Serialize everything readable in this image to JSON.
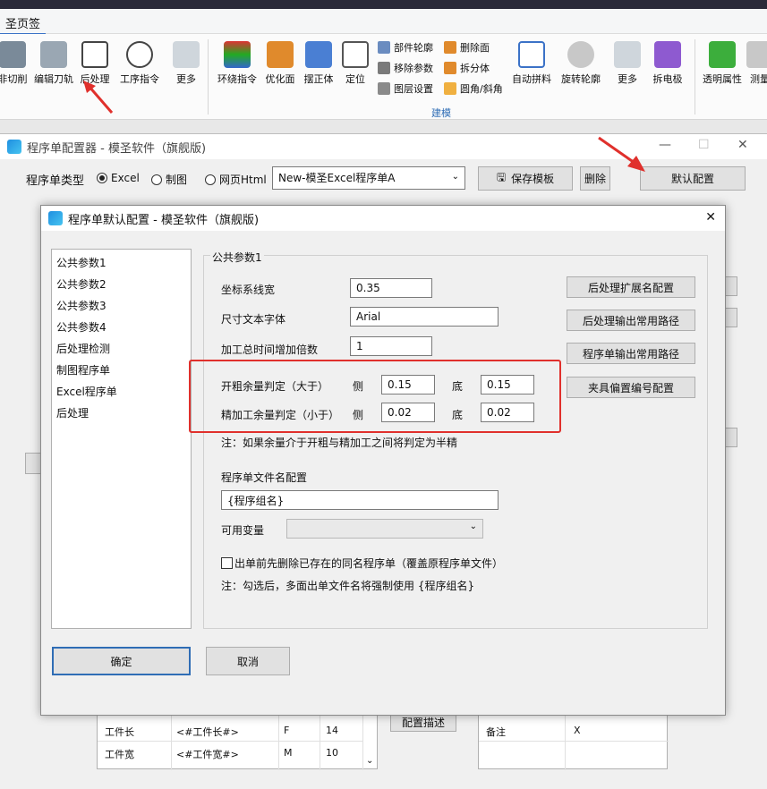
{
  "ribbon": {
    "tab_label": "圣页签",
    "buttons": [
      "非切削",
      "编辑刀轨",
      "后处理",
      "工序指令",
      "更多",
      "环绕指令",
      "优化面",
      "摆正体",
      "定位",
      "自动拼料",
      "旋转轮廓",
      "更多",
      "拆电极",
      "透明属性",
      "测量"
    ],
    "small_buttons": [
      "部件轮廓",
      "移除参数",
      "图层设置",
      "删除面",
      "拆分体",
      "圆角/斜角"
    ],
    "group_label": "建模"
  },
  "outer_window": {
    "title": "程序单配置器 - 模圣软件（旗舰版)",
    "type_label": "程序单类型",
    "radio_excel": "Excel",
    "radio_draw": "制图",
    "radio_html": "网页Html",
    "template_value": "New-模圣Excel程序单A",
    "save_template": "保存模板",
    "delete": "删除",
    "default_config": "默认配置",
    "config_desc": "配置描述"
  },
  "bottom_table": {
    "rows": [
      {
        "name": "工件长",
        "var": "<#工件长#>",
        "code": "F",
        "num": "14"
      },
      {
        "name": "工件宽",
        "var": "<#工件宽#>",
        "code": "M",
        "num": "10"
      }
    ],
    "right_row": {
      "name": "备注",
      "value": "X"
    }
  },
  "dialog": {
    "title": "程序单默认配置 - 模圣软件（旗舰版)",
    "nav": [
      "公共参数1",
      "公共参数2",
      "公共参数3",
      "公共参数4",
      "后处理检测",
      "制图程序单",
      "Excel程序单",
      "后处理"
    ],
    "group_title": "公共参数1",
    "coord_label": "坐标系线宽",
    "coord_value": "0.35",
    "font_label": "尺寸文本字体",
    "font_value": "Arial",
    "time_label": "加工总时间增加倍数",
    "time_value": "1",
    "rough_label": "开粗余量判定（大于）",
    "finish_label": "精加工余量判定（小于）",
    "side_label": "侧",
    "bottom_label": "底",
    "rough_side": "0.15",
    "rough_bottom": "0.15",
    "finish_side": "0.02",
    "finish_bottom": "0.02",
    "note1": "注：如果余量介于开粗与精加工之间将判定为半精",
    "filename_label": "程序单文件名配置",
    "filename_value": "{程序组名}",
    "var_label": "可用变量",
    "checkbox_label": "出单前先删除已存在的同名程序单（覆盖原程序单文件）",
    "note2": "注：勾选后，多面出单文件名将强制使用 {程序组名}",
    "btn_ext": "后处理扩展名配置",
    "btn_post_path": "后处理输出常用路径",
    "btn_sheet_path": "程序单输出常用路径",
    "btn_fixture": "夹具偏置编号配置",
    "ok": "确定",
    "cancel": "取消"
  },
  "colors": {
    "highlight": "#e0302c",
    "accent": "#2f6db5"
  }
}
